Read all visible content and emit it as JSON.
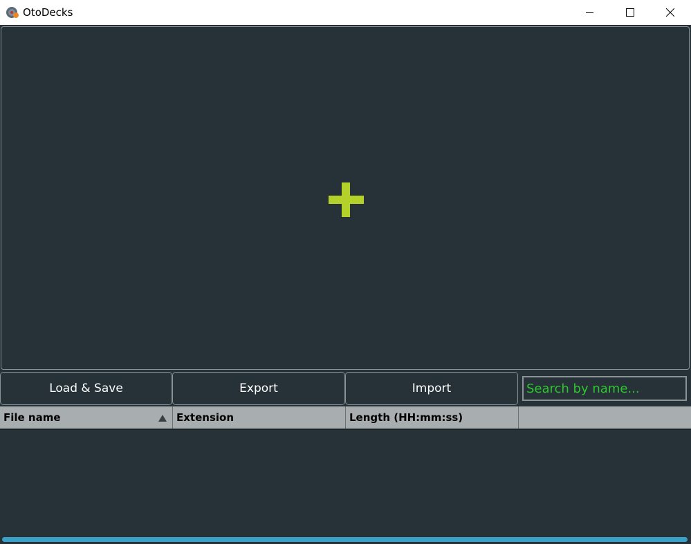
{
  "window": {
    "title": "OtoDecks",
    "controls": {
      "minimize": "minimize-icon",
      "maximize": "maximize-icon",
      "close": "close-icon"
    }
  },
  "deck": {
    "add_icon": "plus-icon",
    "accent_color": "#b4d12a"
  },
  "toolbar": {
    "load_save_label": "Load & Save",
    "export_label": "Export",
    "import_label": "Import"
  },
  "search": {
    "placeholder": "Search by name...",
    "value": ""
  },
  "table": {
    "columns": [
      "File name",
      "Extension",
      "Length (HH:mm:ss)",
      ""
    ],
    "sort_column": "File name",
    "sort_direction": "ascending",
    "rows": []
  },
  "colors": {
    "background": "#263238",
    "border": "#8a9396",
    "header_bg": "#a8adb0",
    "search_text": "#2fc52f",
    "scrollbar": "#3aa0c8"
  }
}
